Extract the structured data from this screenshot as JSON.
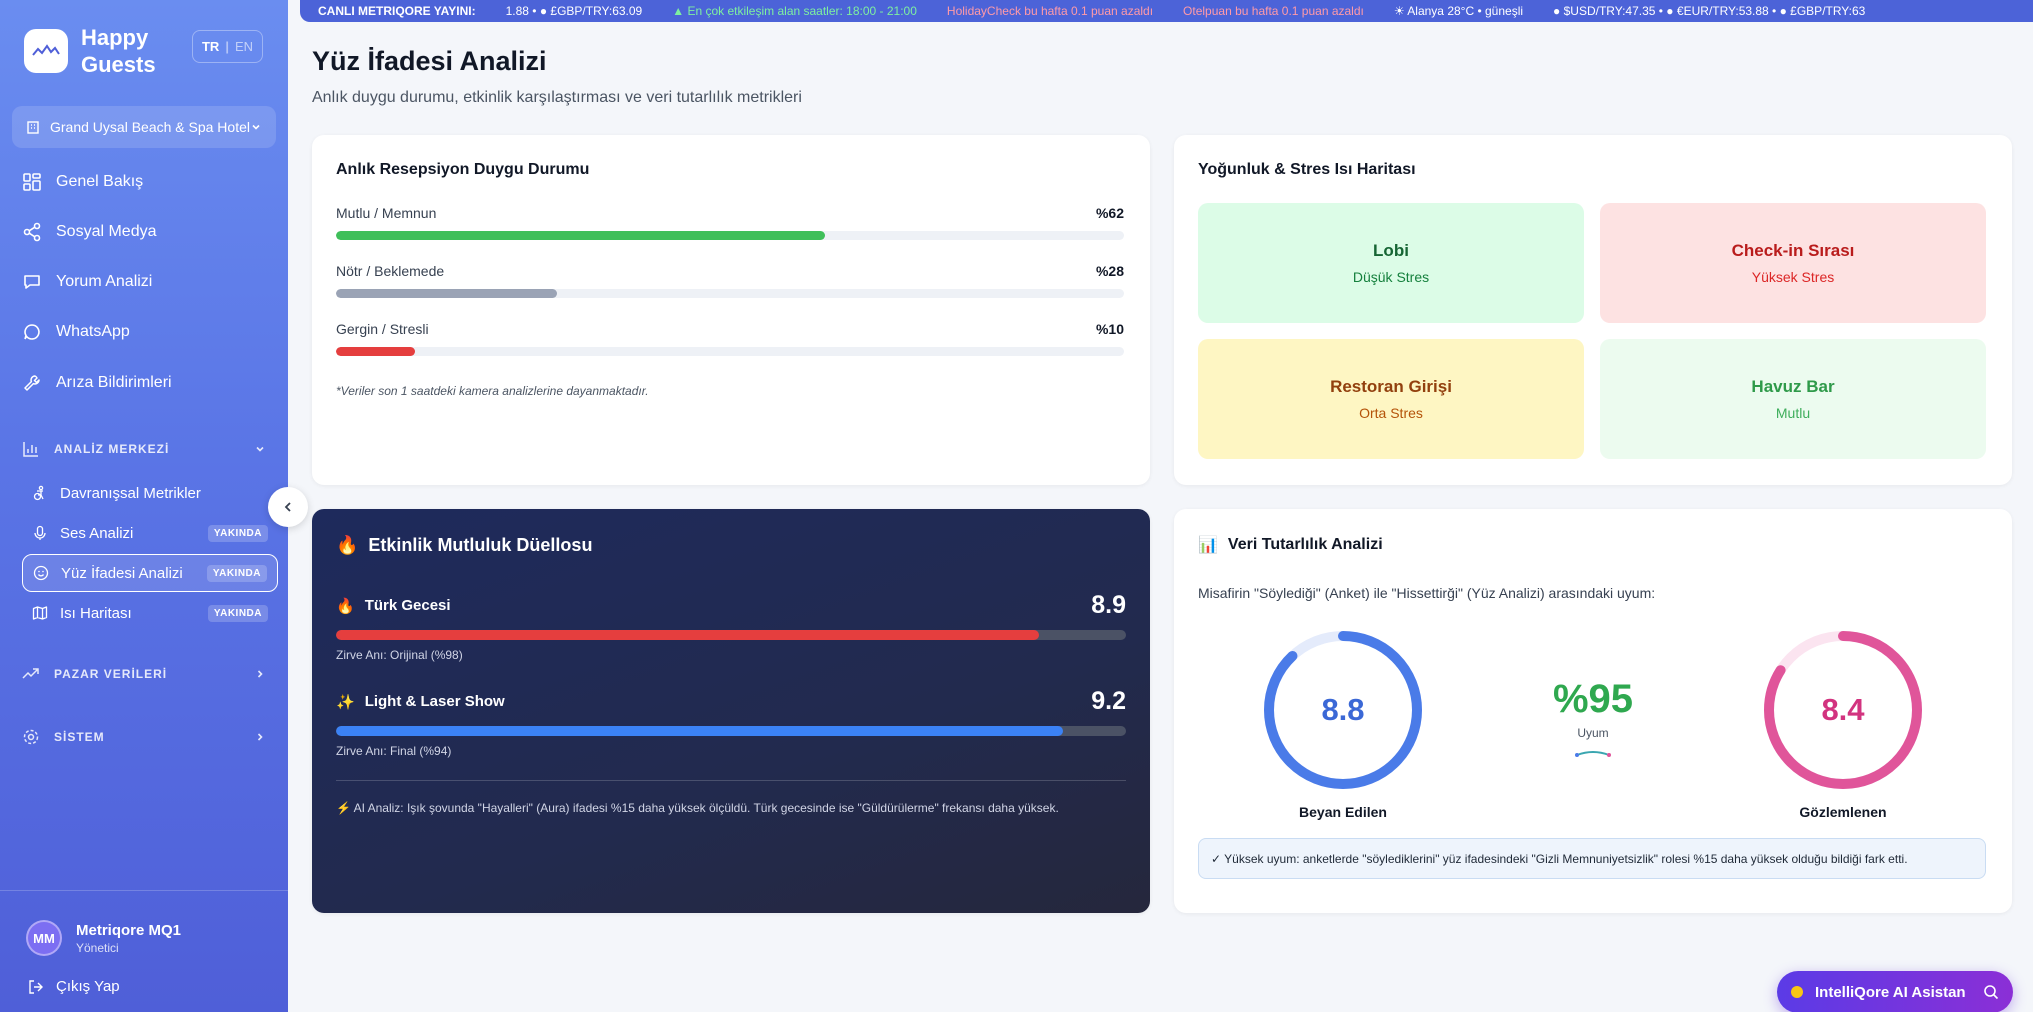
{
  "app": {
    "brand": "Happy Guests",
    "lang_active": "TR",
    "lang_other": "EN"
  },
  "sidebar": {
    "hotel": "Grand Uysal Beach & Spa Hotel",
    "nav": [
      {
        "label": "Genel Bakış",
        "icon": "grid-icon"
      },
      {
        "label": "Sosyal Medya",
        "icon": "share-icon"
      },
      {
        "label": "Yorum Analizi",
        "icon": "comment-icon"
      },
      {
        "label": "WhatsApp",
        "icon": "chat-icon"
      },
      {
        "label": "Arıza Bildirimleri",
        "icon": "wrench-icon"
      }
    ],
    "analysis_section": "ANALİZ MERKEZİ",
    "sub_items": [
      {
        "label": "Davranışsal Metrikler",
        "badge": ""
      },
      {
        "label": "Ses Analizi",
        "badge": "YAKINDA"
      },
      {
        "label": "Yüz İfadesi Analizi",
        "badge": "YAKINDA"
      },
      {
        "label": "Isı Haritası",
        "badge": "YAKINDA"
      }
    ],
    "market_section": "PAZAR VERİLERİ",
    "system_section": "SİSTEM",
    "user": {
      "initials": "MM",
      "name": "Metriqore MQ1",
      "role": "Yönetici"
    },
    "logout": "Çıkış Yap"
  },
  "ticker": {
    "title": "CANLI METRIQORE YAYINI:",
    "items": [
      "1.88 • ● £GBP/TRY:63.09",
      "▲ En çok etkileşim alan saatler: 18:00 - 21:00",
      "HolidayCheck bu hafta 0.1 puan azaldı",
      "Otelpuan bu hafta 0.1 puan azaldı",
      "☀ Alanya 28°C • güneşli",
      "● $USD/TRY:47.35 • ● €EUR/TRY:53.88 • ● £GBP/TRY:63"
    ]
  },
  "page": {
    "title": "Yüz İfadesi Analizi",
    "subtitle": "Anlık duygu durumu, etkinlik karşılaştırması ve veri tutarlılık metrikleri"
  },
  "emotion": {
    "title": "Anlık Resepsiyon Duygu Durumu",
    "rows": [
      {
        "label": "Mutlu / Memnun",
        "value": "%62",
        "pct": 62,
        "color": "#3fbf5a"
      },
      {
        "label": "Nötr / Beklemede",
        "value": "%28",
        "pct": 28,
        "color": "#9aa3b5"
      },
      {
        "label": "Gergin / Stresli",
        "value": "%10",
        "pct": 10,
        "color": "#e53e3e"
      }
    ],
    "note": "*Veriler son 1 saatdeki kamera analizlerine dayanmaktadır."
  },
  "heatmap": {
    "title": "Yoğunluk & Stres Isı Haritası",
    "zones": [
      {
        "name": "Lobi",
        "status": "Düşük Stres"
      },
      {
        "name": "Check-in Sırası",
        "status": "Yüksek Stres"
      },
      {
        "name": "Restoran Girişi",
        "status": "Orta Stres"
      },
      {
        "name": "Havuz Bar",
        "status": "Mutlu"
      }
    ]
  },
  "duel": {
    "title": "Etkinlik Mutluluk Düellosu",
    "title_emoji": "🔥",
    "events": [
      {
        "emoji": "🔥",
        "name": "Türk Gecesi",
        "score": "8.9",
        "pct": 89,
        "peak": "Zirve Anı: Orijinal (%98)",
        "color": "#e53e3e"
      },
      {
        "emoji": "✨",
        "name": "Light & Laser Show",
        "score": "9.2",
        "pct": 92,
        "peak": "Zirve Anı: Final (%94)",
        "color": "#3b82f6"
      }
    ],
    "ai_note": "⚡ AI Analiz: Işık şovunda \"Hayalleri\" (Aura) ifadesi %15 daha yüksek ölçüldü. Türk gecesinde ise \"Güldürülerme\" frekansı daha yüksek."
  },
  "consistency": {
    "title": "Veri Tutarlılık Analizi",
    "title_emoji": "📊",
    "desc": "Misafirin \"Söylediği\" (Anket) ile \"Hissettirği\" (Yüz Analizi) arasındaki uyum:",
    "declared": {
      "value": "8.8",
      "label": "Beyan Edilen",
      "score": 8.8,
      "color": "#4a7be8"
    },
    "match": {
      "value": "%95",
      "label": "Uyum"
    },
    "observed": {
      "value": "8.4",
      "label": "Gözlemlenen",
      "score": 8.4,
      "color": "#e0559a"
    },
    "note": "✓ Yüksek uyum: anketlerde \"söylediklerini\" yüz ifadesindeki \"Gizli Memnuniyetsizlik\" rolesi %15 daha yüksek olduğu bildiği fark etti."
  },
  "assistant": {
    "label": "IntelliQore AI Asistan"
  }
}
